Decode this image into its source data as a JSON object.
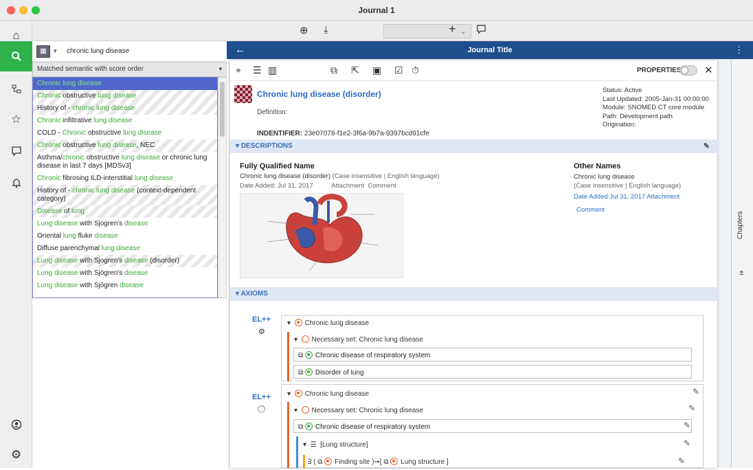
{
  "window": {
    "title": "Journal 1"
  },
  "nav": {
    "items": [
      "home",
      "search",
      "tree",
      "star",
      "comment",
      "bell",
      "user",
      "settings"
    ]
  },
  "toolbar": {
    "select_value": ""
  },
  "search": {
    "query": "chronic lung disease",
    "match_mode": "Matched semantic with score order"
  },
  "results": [
    {
      "pre": "",
      "h1": "Chronic lung disease",
      "mid": "",
      "h2": "",
      "post": "",
      "sel": true,
      "striped": false
    },
    {
      "pre": "",
      "h1": "Chronic",
      "mid": " obstructive ",
      "h2": "lung disease",
      "post": "",
      "sel": false,
      "striped": true
    },
    {
      "pre": "History of - ",
      "h1": "chronic lung disease",
      "mid": "",
      "h2": "",
      "post": "",
      "sel": false,
      "striped": true
    },
    {
      "pre": "",
      "h1": "Chronic",
      "mid": " infiltrative ",
      "h2": "lung disease",
      "post": "",
      "sel": false,
      "striped": false
    },
    {
      "pre": "COLD - ",
      "h1": "Chronic",
      "mid": " obstructive ",
      "h2": "lung disease",
      "post": "",
      "sel": false,
      "striped": false
    },
    {
      "pre": "",
      "h1": "Chronic",
      "mid": " obstructive ",
      "h2": "lung disease",
      "post": ", NEC",
      "sel": false,
      "striped": true
    },
    {
      "pre": "Asthma/",
      "h1": "chronic",
      "mid": " obstructive ",
      "h2": "lung disease",
      "post": " or chronic lung disease in last 7 days [MDSv3]",
      "sel": false,
      "striped": false
    },
    {
      "pre": "",
      "h1": "Chronic",
      "mid": " fibrosing ILD-interstitial ",
      "h2": "lung disease",
      "post": "",
      "sel": false,
      "striped": false
    },
    {
      "pre": "History of - ",
      "h1": "chronic lung disease",
      "mid": "",
      "h2": "",
      "post": " (context-dependent category)",
      "sel": false,
      "striped": true
    },
    {
      "pre": "",
      "h1": "Disease",
      "mid": " of ",
      "h2": "lung",
      "post": "",
      "sel": false,
      "striped": true
    },
    {
      "pre": "",
      "h1": "Lung disease",
      "mid": " with Sjogren's ",
      "h2": "disease",
      "post": "",
      "sel": false,
      "striped": false
    },
    {
      "pre": "Oriental ",
      "h1": "lung",
      "mid": " fluke ",
      "h2": "disease",
      "post": "",
      "sel": false,
      "striped": false
    },
    {
      "pre": "Diffuse parenchymal ",
      "h1": "lung disease",
      "mid": "",
      "h2": "",
      "post": "",
      "sel": false,
      "striped": false
    },
    {
      "pre": "",
      "h1": "Lung disease",
      "mid": " with Sjogren's ",
      "h2": "disease",
      "post": " (disorder)",
      "sel": false,
      "striped": true
    },
    {
      "pre": "",
      "h1": "Lung disease",
      "mid": " with Sjögren's ",
      "h2": "disease",
      "post": "",
      "sel": false,
      "striped": false
    },
    {
      "pre": "",
      "h1": "Lung disease",
      "mid": " with Sjögren ",
      "h2": "disease",
      "post": "",
      "sel": false,
      "striped": false
    }
  ],
  "journal": {
    "title": "Journal Title"
  },
  "chapters": {
    "label": "Chapters"
  },
  "concept": {
    "properties_label": "PROPERTIES",
    "name": "Chronic lung disease (disorder)",
    "definition_label": "Definition:",
    "identifier_label": "INDENTIFIER:",
    "identifier": "23e07078-f1e2-3f6a-9b7a-9397bcd91cfe",
    "status": "Status: Active",
    "last_updated": "Last Updated: 2005-Jan-31 00:00:00",
    "module": "Module: SNOMED CT core module",
    "path": "Path: Development path",
    "origination": "Origination:"
  },
  "descriptions": {
    "header": "DESCRIPTIONS",
    "fqn_title": "Fully Qualified Name",
    "fqn_text": "Chronic lung disease (disorder)",
    "fqn_qual": " (Case insensitive | English language)",
    "fqn_date": "Date Added:   Jul 31, 2017",
    "fqn_attach": "Attachment",
    "fqn_comment": "Comment",
    "other_title": "Other Names",
    "other_text": "Chronic lung disease",
    "other_qual": "(Case insensitive | English language)",
    "other_date": "Date Added:Jul 31, 2017",
    "other_attach": "Attachment",
    "other_comment": "Comment"
  },
  "axioms": {
    "header": "AXIOMS",
    "el": "EL++",
    "concept": "Chronic lung disease",
    "nec_set": "Necessary set: Chronic lung disease",
    "parent1": "Chronic disease of respiratory system",
    "parent2": "Disorder of lung",
    "role_group": "[Lung structure]",
    "exists_prefix": "∃ (",
    "role": "Finding site",
    "arrow": ")➞[",
    "target": "Lung structure",
    "close": "]"
  },
  "colors": {
    "accent_green": "#2fb24a",
    "journal_blue": "#1e4f8d",
    "link_blue": "#2a6bc4",
    "highlight_green": "#3ca635"
  }
}
